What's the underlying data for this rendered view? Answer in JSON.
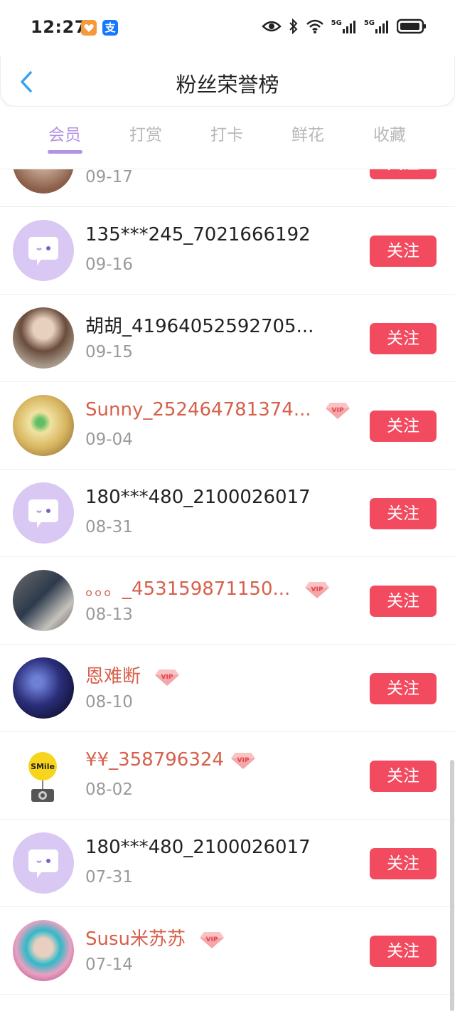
{
  "status": {
    "time": "12:27",
    "app_icon_1": "支",
    "net1": "5G",
    "net2": "5G"
  },
  "header": {
    "title": "粉丝荣誉榜"
  },
  "tabs": [
    {
      "label": "会员",
      "active": true
    },
    {
      "label": "打赏",
      "active": false
    },
    {
      "label": "打卡",
      "active": false
    },
    {
      "label": "鲜花",
      "active": false
    },
    {
      "label": "收藏",
      "active": false
    }
  ],
  "follow_label": "关注",
  "vip_label": "VIP",
  "rows": [
    {
      "name": "",
      "date": "09-17",
      "vip": false,
      "avatar": "photo-cat"
    },
    {
      "name": "135***245_7021666192",
      "date": "09-16",
      "vip": false,
      "avatar": "default"
    },
    {
      "name": "胡胡_41964052592705...",
      "date": "09-15",
      "vip": false,
      "avatar": "photo-girl"
    },
    {
      "name": "Sunny_252464781374...",
      "date": "09-04",
      "vip": true,
      "avatar": "photo-blonde"
    },
    {
      "name": "180***480_2100026017",
      "date": "08-31",
      "vip": false,
      "avatar": "default"
    },
    {
      "name": "。。。_453159871150...",
      "date": "08-13",
      "vip": true,
      "avatar": "photo-kids"
    },
    {
      "name": "恩难断",
      "date": "08-10",
      "vip": true,
      "avatar": "photo-dark"
    },
    {
      "name": "¥¥_358796324",
      "date": "08-02",
      "vip": true,
      "avatar": "smile-camera"
    },
    {
      "name": "180***480_2100026017",
      "date": "07-31",
      "vip": false,
      "avatar": "default"
    },
    {
      "name": "Susu米苏苏",
      "date": "07-14",
      "vip": true,
      "avatar": "photo-pinkhair"
    }
  ]
}
